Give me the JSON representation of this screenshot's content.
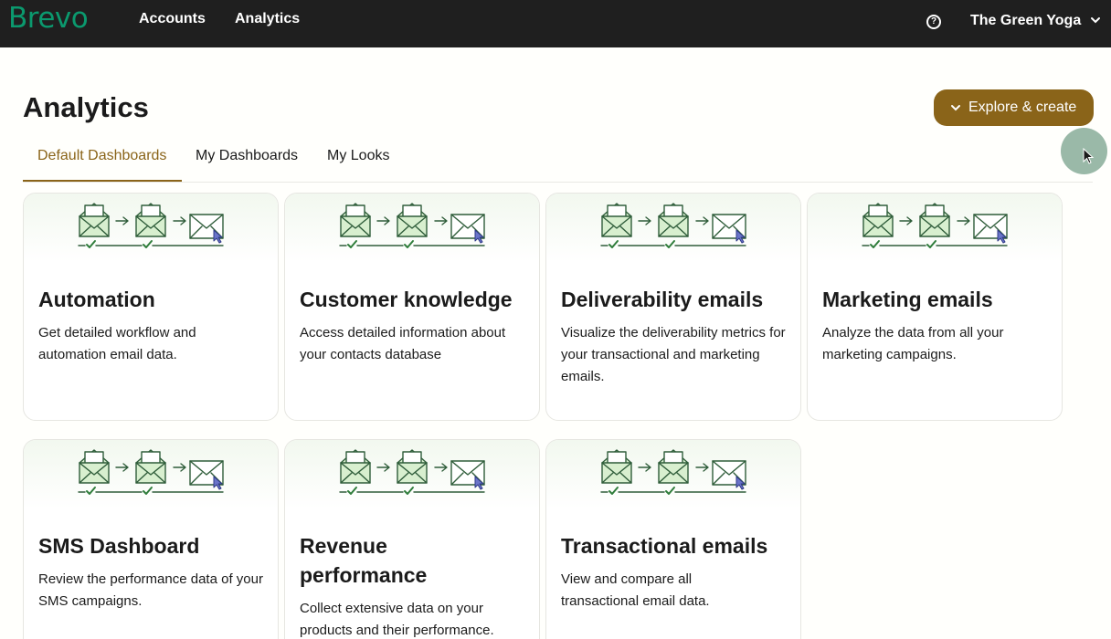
{
  "topbar": {
    "brand": "Brevo",
    "nav": [
      "Accounts",
      "Analytics"
    ],
    "account_name": "The Green Yoga"
  },
  "page": {
    "title": "Analytics",
    "explore_button": "Explore & create"
  },
  "tabs": [
    "Default Dashboards",
    "My Dashboards",
    "My Looks"
  ],
  "active_tab": "Default Dashboards",
  "cards": [
    {
      "title": "Automation",
      "description": "Get detailed workflow and automation email data."
    },
    {
      "title": "Customer knowledge",
      "description": "Access detailed information about your contacts database"
    },
    {
      "title": "Deliverability emails",
      "description": "Visualize the deliverability metrics for your transactional and marketing emails."
    },
    {
      "title": "Marketing emails",
      "description": "Analyze the data from all your marketing campaigns."
    },
    {
      "title": "SMS Dashboard",
      "description": "Review the performance data of your SMS campaigns."
    },
    {
      "title": "Revenue performance",
      "description": "Collect extensive data on your products and their performance."
    },
    {
      "title": "Transactional emails",
      "description": "View and compare all transactional email data."
    }
  ],
  "colors": {
    "topbar": "#1f1f1f",
    "brand": "#0b996e",
    "accent": "#8a6419",
    "illustration_green": "#2f6b3d"
  },
  "icons": [
    "help-circle-icon",
    "chevron-down-icon",
    "email-flow-illustration",
    "mouse-pointer-icon"
  ]
}
